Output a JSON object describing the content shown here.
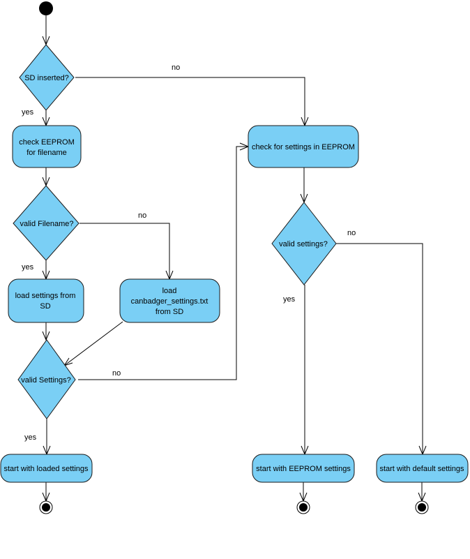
{
  "diagram": {
    "type": "UML activity diagram",
    "colors": {
      "node_fill": "#7acff5",
      "node_stroke": "#1a1a1a",
      "edge": "#000000",
      "background": "#ffffff"
    },
    "nodes": {
      "start": {
        "kind": "initial"
      },
      "sd_inserted": {
        "kind": "decision",
        "label": "SD inserted?"
      },
      "check_eeprom_filename": {
        "kind": "action",
        "lines": [
          "check EEPROM",
          "for filename"
        ]
      },
      "valid_filename": {
        "kind": "decision",
        "label": "valid Filename?"
      },
      "load_settings_sd": {
        "kind": "action",
        "lines": [
          "load settings from",
          "SD"
        ]
      },
      "load_canbadger": {
        "kind": "action",
        "lines": [
          "load",
          "canbadger_settings.txt",
          "from SD"
        ]
      },
      "valid_settings_sd": {
        "kind": "decision",
        "label": "valid Settings?"
      },
      "start_loaded": {
        "kind": "action",
        "lines": [
          "start with loaded settings"
        ]
      },
      "end_loaded": {
        "kind": "final"
      },
      "check_settings_eeprom": {
        "kind": "action",
        "lines": [
          "check  for settings in EEPROM"
        ]
      },
      "valid_settings_eeprom": {
        "kind": "decision",
        "label": "valid settings?"
      },
      "start_eeprom": {
        "kind": "action",
        "lines": [
          "start with EEPROM settings"
        ]
      },
      "end_eeprom": {
        "kind": "final"
      },
      "start_default": {
        "kind": "action",
        "lines": [
          "start with default settings"
        ]
      },
      "end_default": {
        "kind": "final"
      }
    },
    "edges": [
      {
        "from": "start",
        "to": "sd_inserted",
        "label": ""
      },
      {
        "from": "sd_inserted",
        "to": "check_eeprom_filename",
        "label": "yes"
      },
      {
        "from": "sd_inserted",
        "to": "check_settings_eeprom",
        "label": "no"
      },
      {
        "from": "check_eeprom_filename",
        "to": "valid_filename",
        "label": ""
      },
      {
        "from": "valid_filename",
        "to": "load_settings_sd",
        "label": "yes"
      },
      {
        "from": "valid_filename",
        "to": "load_canbadger",
        "label": "no"
      },
      {
        "from": "load_settings_sd",
        "to": "valid_settings_sd",
        "label": ""
      },
      {
        "from": "load_canbadger",
        "to": "valid_settings_sd",
        "label": ""
      },
      {
        "from": "valid_settings_sd",
        "to": "start_loaded",
        "label": "yes"
      },
      {
        "from": "valid_settings_sd",
        "to": "check_settings_eeprom",
        "label": "no"
      },
      {
        "from": "start_loaded",
        "to": "end_loaded",
        "label": ""
      },
      {
        "from": "check_settings_eeprom",
        "to": "valid_settings_eeprom",
        "label": ""
      },
      {
        "from": "valid_settings_eeprom",
        "to": "start_eeprom",
        "label": "yes"
      },
      {
        "from": "valid_settings_eeprom",
        "to": "start_default",
        "label": "no"
      },
      {
        "from": "start_eeprom",
        "to": "end_eeprom",
        "label": ""
      },
      {
        "from": "start_default",
        "to": "end_default",
        "label": ""
      }
    ],
    "edge_labels": {
      "sd_no": "no",
      "sd_yes": "yes",
      "filename_no": "no",
      "filename_yes": "yes",
      "settings_sd_no": "no",
      "settings_sd_yes": "yes",
      "settings_eeprom_no": "no",
      "settings_eeprom_yes": "yes"
    }
  }
}
